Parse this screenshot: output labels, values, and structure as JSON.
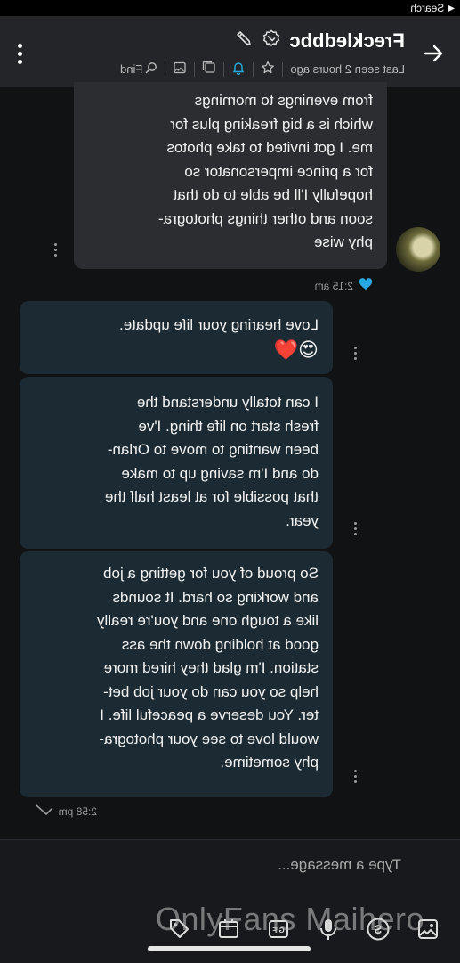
{
  "status": {
    "back_label": "Search"
  },
  "header": {
    "name": "Freckledbbc",
    "last_seen": "Last seen 2 hours ago",
    "find_label": "Find"
  },
  "messages": [
    {
      "id": "in1",
      "text": "from evenings to mornings\nwhich is a big freaking plus for\nme. I got invited to take photos\nfor a prince impersonator so\nhopefully I'll be able to do that\nsoon and other things photogra-\nphy wise"
    },
    {
      "id": "out1",
      "text": "Love hearing your life update.",
      "emoji": "😍❤️"
    },
    {
      "id": "out2",
      "text": "I can totally understand the\nfresh start on life thing. I've\nbeen wanting to move to Orlan-\ndo and I'm saving up to make\nthat possible for at least half the\nyear."
    },
    {
      "id": "out3",
      "text": "So proud of you for getting a job\nand working so hard. It sounds\nlike a tough one and you're really\ngood at holding down the ass\nstation. I'm glad they hired more\nhelp so you can do your job bet-\nter. You deserve a peaceful life. I\nwould love to see your photogra-\nphy sometime."
    }
  ],
  "timestamps": {
    "first": "2:15 am",
    "second": "2:58 pm"
  },
  "composer": {
    "placeholder": "Type a message...",
    "watermark": "OnlyFans Maihero"
  },
  "colors": {
    "accent": "#29a9e1",
    "incoming_bubble": "#2c2d31",
    "outgoing_bubble": "#1c2b33"
  }
}
